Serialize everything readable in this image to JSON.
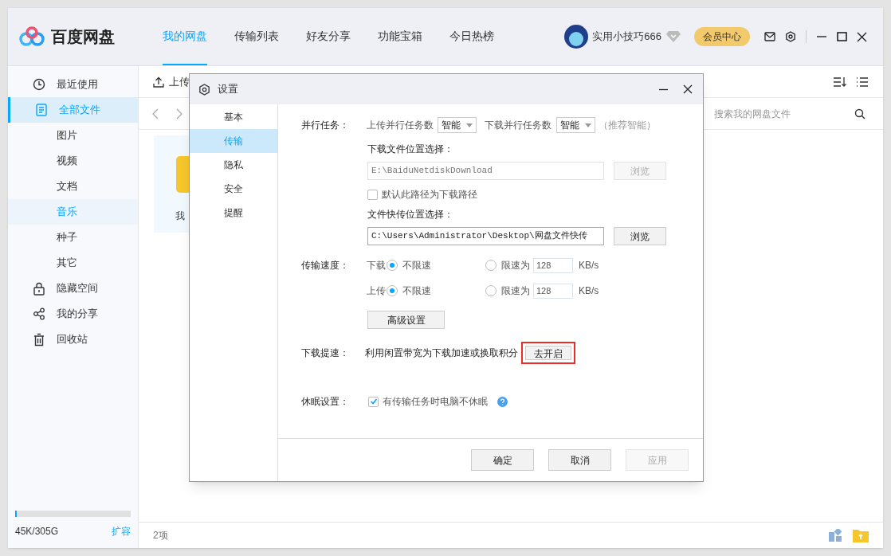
{
  "app": {
    "logo": "百度网盘",
    "nav": [
      {
        "label": "我的网盘",
        "selected": true
      },
      {
        "label": "传输列表",
        "selected": false
      },
      {
        "label": "好友分享",
        "selected": false
      },
      {
        "label": "功能宝箱",
        "selected": false
      },
      {
        "label": "今日热榜",
        "selected": false
      }
    ],
    "user": {
      "name": "实用小技巧666"
    },
    "vip_button": "会员中心"
  },
  "sidebar": {
    "items": [
      {
        "label": "最近使用",
        "selected": false
      },
      {
        "label": "全部文件",
        "selected": true,
        "children": [
          {
            "label": "图片",
            "selected": false
          },
          {
            "label": "视频",
            "selected": false
          },
          {
            "label": "文档",
            "selected": false
          },
          {
            "label": "音乐",
            "selected": true
          },
          {
            "label": "种子",
            "selected": false
          },
          {
            "label": "其它",
            "selected": false
          }
        ]
      },
      {
        "label": "隐藏空间",
        "selected": false
      },
      {
        "label": "我的分享",
        "selected": false
      },
      {
        "label": "回收站",
        "selected": false
      }
    ],
    "storage": {
      "level": 0.01,
      "text": "45K/305G",
      "link": "扩容"
    }
  },
  "toolbar": {
    "upload": "上传"
  },
  "search": {
    "placeholder": "搜索我的网盘文件"
  },
  "files": [
    {
      "name": "我"
    }
  ],
  "status_bar": "2项",
  "dialog": {
    "title": "设置",
    "tabs": [
      {
        "label": "基本",
        "selected": false
      },
      {
        "label": "传输",
        "selected": true
      },
      {
        "label": "隐私",
        "selected": false
      },
      {
        "label": "安全",
        "selected": false
      },
      {
        "label": "提醒",
        "selected": false
      }
    ],
    "parallel": {
      "label": "并行任务：",
      "upload_label": "上传并行任务数",
      "upload_value": "智能",
      "download_label": "下载并行任务数",
      "download_value": "智能",
      "hint": "（推荐智能）"
    },
    "download_location": {
      "label": "下载文件位置选择：",
      "value": "E:\\BaiduNetdiskDownload",
      "disabled": true,
      "browse": "浏览"
    },
    "default_path": {
      "label": "默认此路径为下载路径",
      "checked": false
    },
    "quick_location": {
      "label": "文件快传位置选择：",
      "value": "C:\\Users\\Administrator\\Desktop\\网盘文件快传",
      "disabled": false,
      "browse": "浏览"
    },
    "speed": {
      "label": "传输速度：",
      "rows": [
        {
          "label": "下载",
          "options": [
            {
              "label": "不限速",
              "selected": true
            },
            {
              "label": "限速为",
              "selected": false
            }
          ],
          "value": "128",
          "unit": "KB/s"
        },
        {
          "label": "上传",
          "options": [
            {
              "label": "不限速",
              "selected": true
            },
            {
              "label": "限速为",
              "selected": false
            }
          ],
          "value": "128",
          "unit": "KB/s"
        }
      ]
    },
    "advanced_button": "高级设置",
    "boost": {
      "label": "下载提速：",
      "text": "利用闲置带宽为下载加速或换取积分",
      "button": "去开启",
      "highlighted": true
    },
    "sleep": {
      "label": "休眠设置：",
      "option": "有传输任务时电脑不休眠",
      "checked": true
    },
    "buttons": [
      {
        "label": "确定",
        "disabled": false
      },
      {
        "label": "取消",
        "disabled": false
      },
      {
        "label": "应用",
        "disabled": true
      }
    ]
  }
}
